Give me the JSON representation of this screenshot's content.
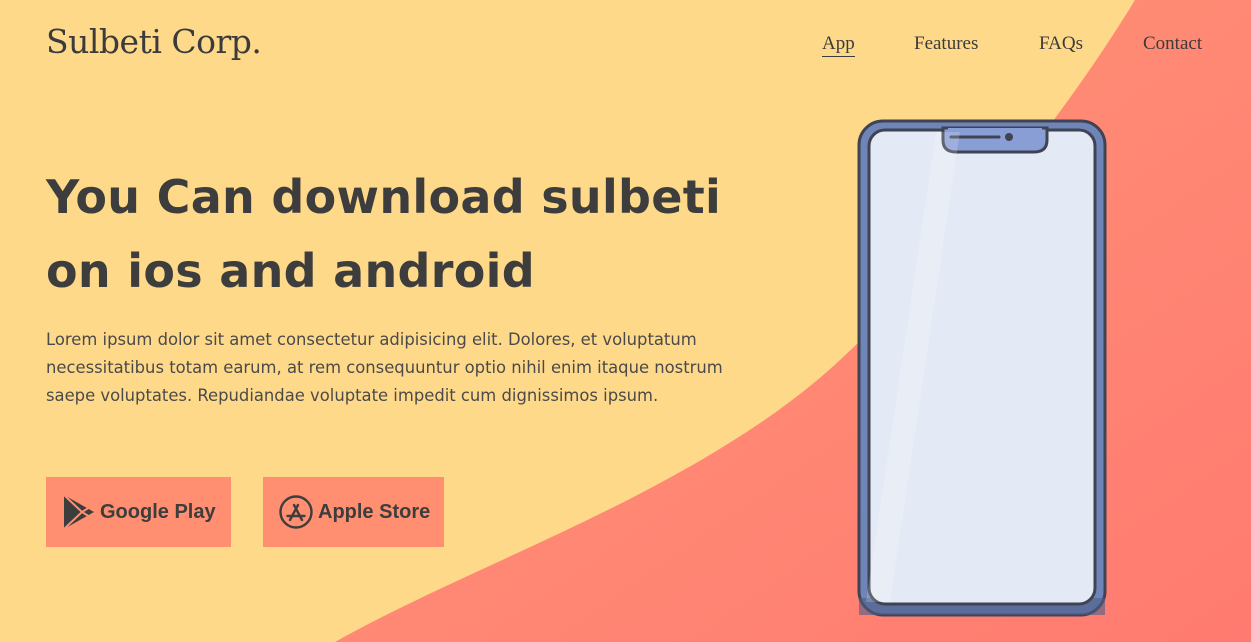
{
  "brand": {
    "logo": "Sulbeti Corp."
  },
  "nav": {
    "items": [
      {
        "label": "App",
        "active": true
      },
      {
        "label": "Features"
      },
      {
        "label": "FAQs"
      },
      {
        "label": "Contact"
      }
    ]
  },
  "hero": {
    "headline_line1": "You Can download sulbeti",
    "headline_line2": "on ios and android",
    "description": "Lorem ipsum dolor sit amet consectetur adipisicing elit. Dolores, et voluptatum necessitatibus totam earum, at rem consequuntur optio nihil enim itaque nostrum saepe voluptates. Repudiandae voluptate impedit cum dignissimos ipsum."
  },
  "buttons": {
    "google": {
      "label": "Google Play",
      "icon": "google-play-icon"
    },
    "apple": {
      "label": "Apple Store",
      "icon": "app-store-icon"
    }
  },
  "colors": {
    "background": "#ffd98a",
    "wave": "#ff8a78",
    "button": "#ff8f70",
    "text": "#3d3d3d",
    "phone_frame": "#6f85b8",
    "phone_screen": "#e3e9f5"
  }
}
